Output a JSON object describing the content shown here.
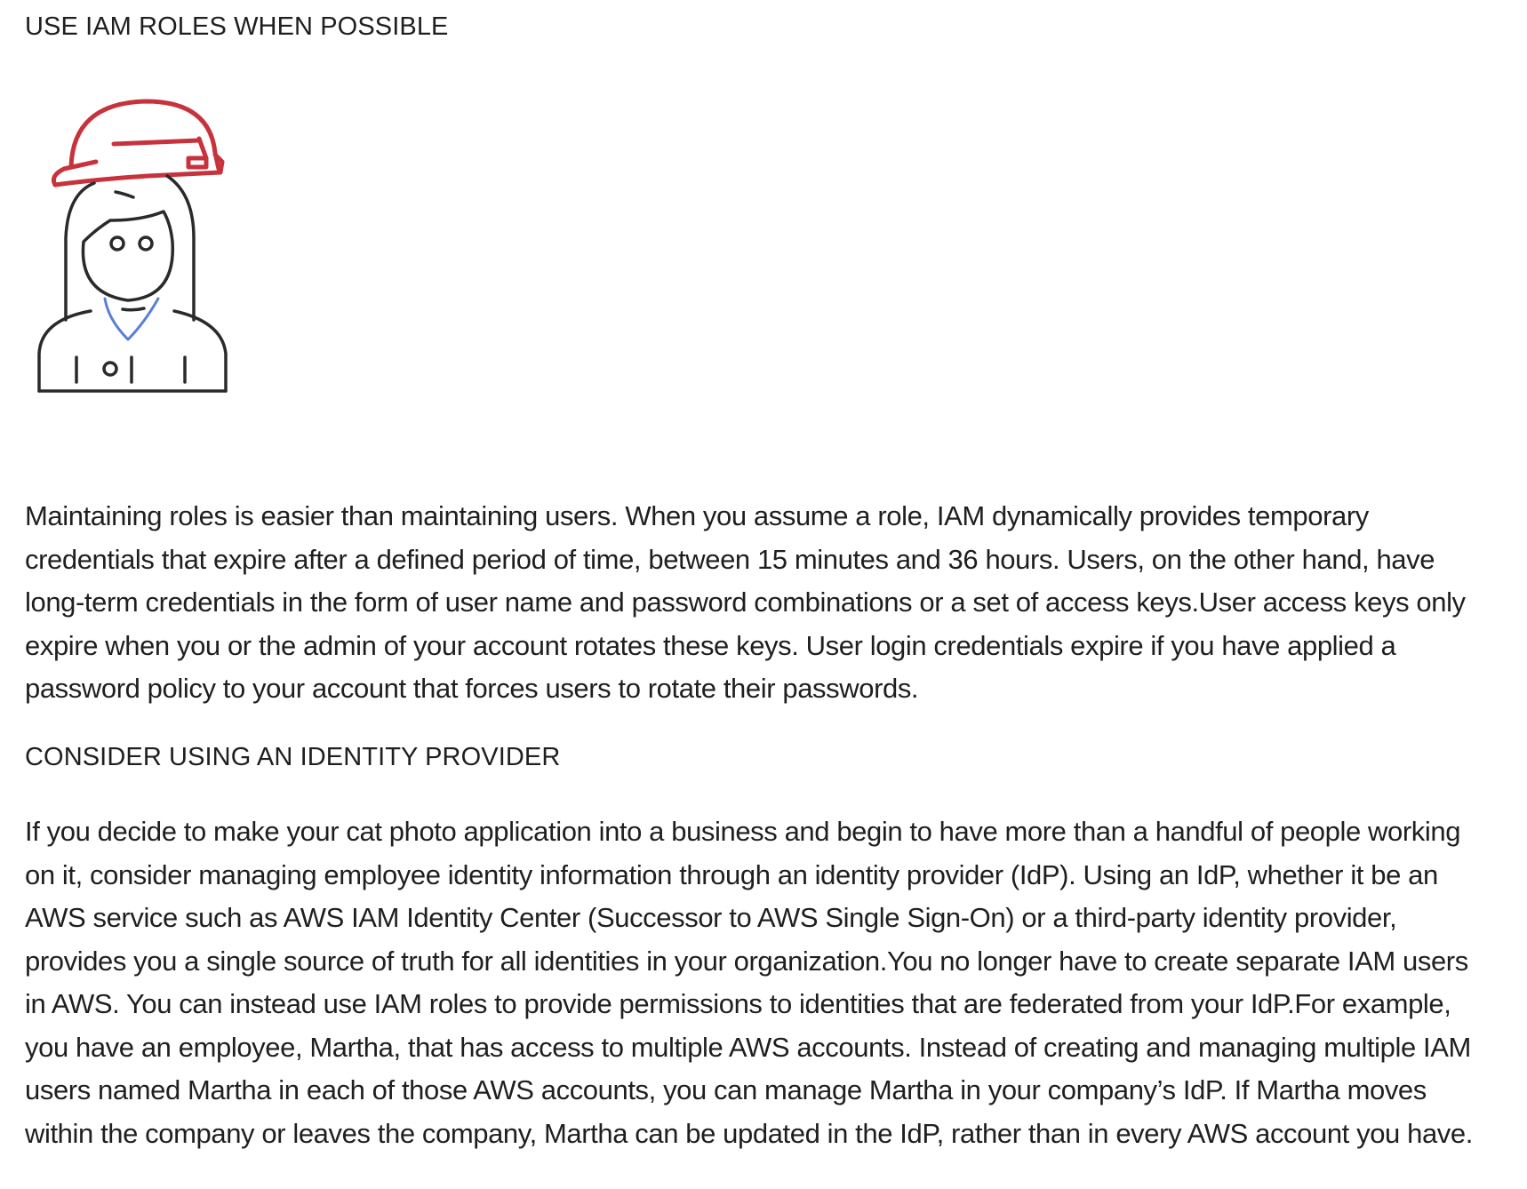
{
  "section1": {
    "heading": "USE IAM ROLES WHEN POSSIBLE",
    "illustration_icon": "person-with-hard-hat-icon",
    "accent_color": "#c8323c",
    "paragraph": "Maintaining roles is easier than maintaining users. When you assume a role, IAM dynamically provides temporary credentials that expire after a defined period of time, between 15 minutes and 36 hours. Users, on the other hand, have long-term credentials in the form of user name and password combinations or a set of access keys.User access keys only expire when you or the admin of your account rotates these keys. User login credentials expire if you have applied a password policy to your account that forces users to rotate their passwords."
  },
  "section2": {
    "heading": "CONSIDER USING AN IDENTITY PROVIDER",
    "paragraph": "If you decide to make your cat photo application into a business and begin to have more than a handful of people working on it, consider managing employee identity information through an identity provider (IdP). Using an IdP, whether it be an AWS service such as AWS IAM Identity Center (Successor to AWS Single Sign-On) or a third-party identity provider, provides you a single source of truth for all identities in your organization.You no longer have to create separate IAM users in AWS. You can instead use IAM roles to provide permissions to identities that are federated from your IdP.For example, you have an employee, Martha, that has access to multiple AWS accounts. Instead of creating and managing multiple IAM users named Martha in each of those AWS accounts, you can manage Martha in your company’s IdP. If Martha moves within the company or leaves the company, Martha can be updated in the IdP, rather than in every AWS account you have."
  }
}
